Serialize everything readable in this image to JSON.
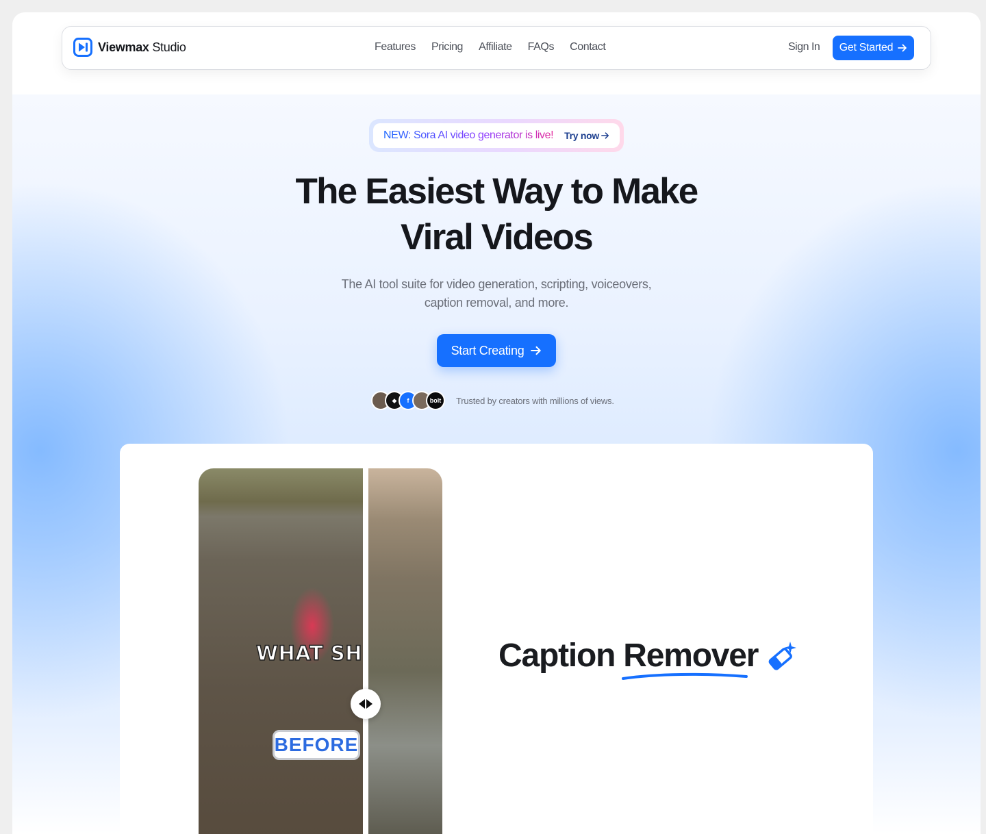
{
  "brand": {
    "bold": "Viewmax",
    "light": " Studio",
    "accent": "#1670ff"
  },
  "nav": {
    "links": [
      "Features",
      "Pricing",
      "Affiliate",
      "FAQs",
      "Contact"
    ],
    "sign_in": "Sign In",
    "get_started": "Get Started"
  },
  "announcement": {
    "text": "NEW: Sora AI video generator is live!",
    "link": "Try now"
  },
  "hero": {
    "title_line1": "The Easiest Way to Make",
    "title_line2": "Viral Videos",
    "subtitle_line1": "The AI tool suite for video generation, scripting, voiceovers,",
    "subtitle_line2": "caption removal, and more.",
    "cta": "Start Creating",
    "trusted": "Trusted by creators with millions of views."
  },
  "avatars": [
    {
      "name": "creator-avatar",
      "color": "#6b5b4e",
      "label": ""
    },
    {
      "name": "brand-logo-avatar",
      "color": "#111111",
      "label": "◆"
    },
    {
      "name": "brand-logo-avatar",
      "color": "#1670ff",
      "label": "f"
    },
    {
      "name": "creator-avatar",
      "color": "#7a6a5c",
      "label": ""
    },
    {
      "name": "bolt-logo-avatar",
      "color": "#0b0b0b",
      "label": "bolt"
    }
  ],
  "showcase": {
    "video_caption": "WHAT SHE",
    "before_label": "BEFORE",
    "title_plain": "Caption",
    "title_underlined": "Remover"
  }
}
